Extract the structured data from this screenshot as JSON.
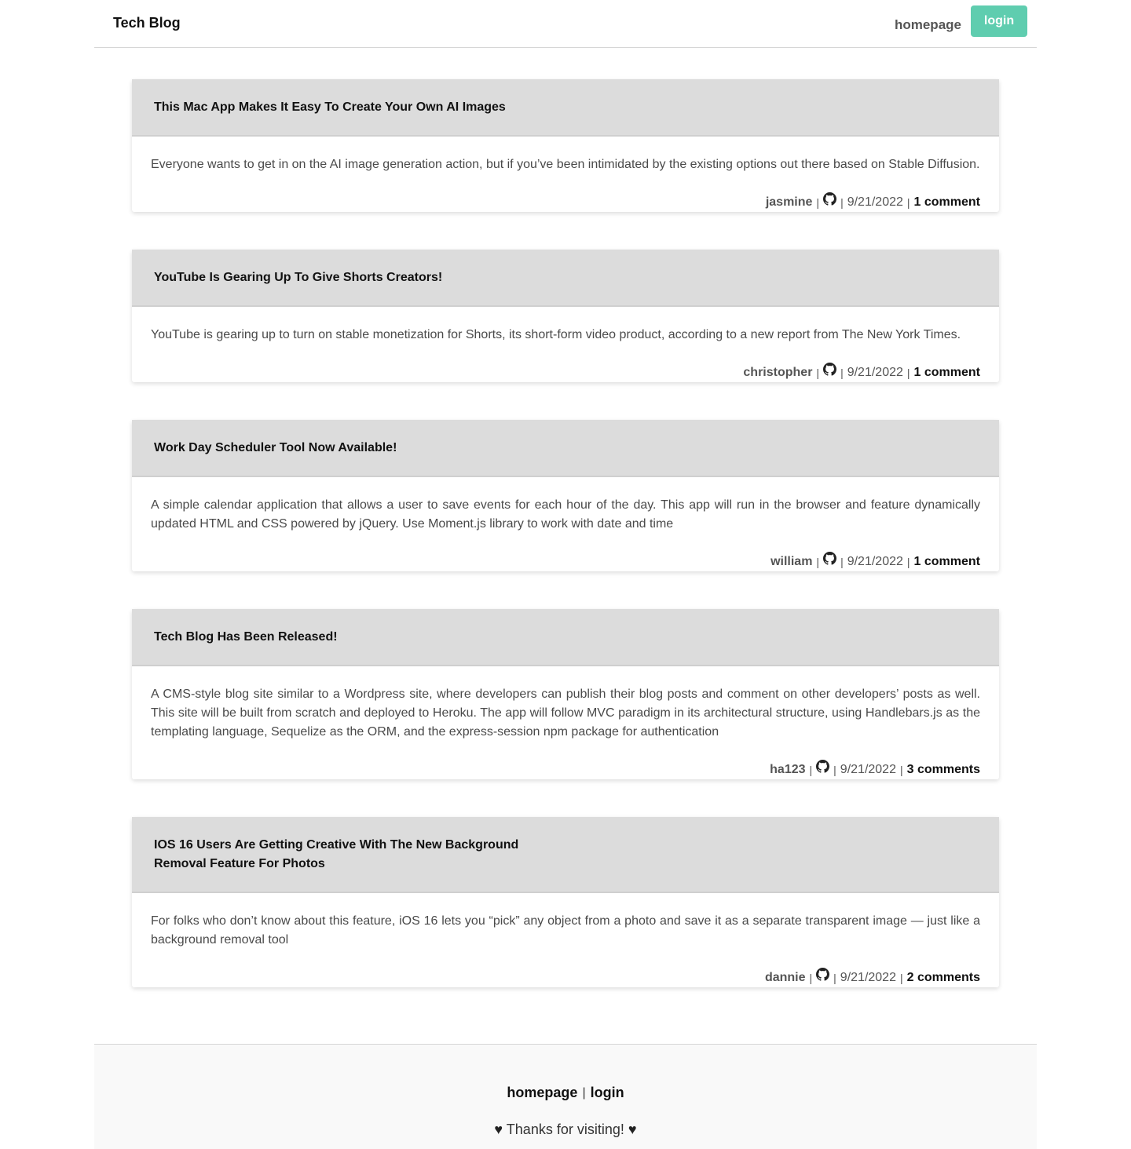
{
  "header": {
    "brand": "Tech Blog",
    "nav_homepage": "homepage",
    "nav_login": "login",
    "accent_color": "#5fcdaf"
  },
  "posts": [
    {
      "title": "This Mac App Makes It Easy To Create Your Own AI Images",
      "body": "Everyone wants to get in on the AI image generation action, but if you’ve been intimidated by the existing options out there based on Stable Diffusion.",
      "author": "jasmine",
      "icon": "github-icon",
      "date": "9/21/2022",
      "comments": "1 comment"
    },
    {
      "title": "YouTube Is Gearing Up To Give Shorts Creators!",
      "body": "YouTube is gearing up to turn on stable monetization for Shorts, its short-form video product, according to a new report from The New York Times.",
      "author": "christopher",
      "icon": "github-icon",
      "date": "9/21/2022",
      "comments": "1 comment"
    },
    {
      "title": "Work Day Scheduler Tool Now Available!",
      "body": "A simple calendar application that allows a user to save events for each hour of the day. This app will run in the browser and feature dynamically updated HTML and CSS powered by jQuery. Use Moment.js library to work with date and time",
      "author": "william",
      "icon": "github-icon",
      "date": "9/21/2022",
      "comments": "1 comment"
    },
    {
      "title": "Tech Blog Has Been Released!",
      "body": "A CMS-style blog site similar to a Wordpress site, where developers can publish their blog posts and comment on other developers’ posts as well. This site will be built from scratch and deployed to Heroku. The app will follow MVC paradigm in its architectural structure, using Handlebars.js as the templating language, Sequelize as the ORM, and the express-session npm package for authentication",
      "author": "ha123",
      "icon": "github-icon",
      "date": "9/21/2022",
      "comments": "3 comments"
    },
    {
      "title": "IOS 16 Users Are Getting Creative With The New Background Removal Feature For Photos",
      "body": "For folks who don’t know about this feature, iOS 16 lets you “pick” any object from a photo and save it as a separate transparent image — just like a background removal tool",
      "author": "dannie",
      "icon": "github-icon",
      "date": "9/21/2022",
      "comments": "2 comments"
    }
  ],
  "footer": {
    "homepage": "homepage",
    "separator": "|",
    "login": "login",
    "thanks": "Thanks for visiting!",
    "heart": "♥"
  }
}
